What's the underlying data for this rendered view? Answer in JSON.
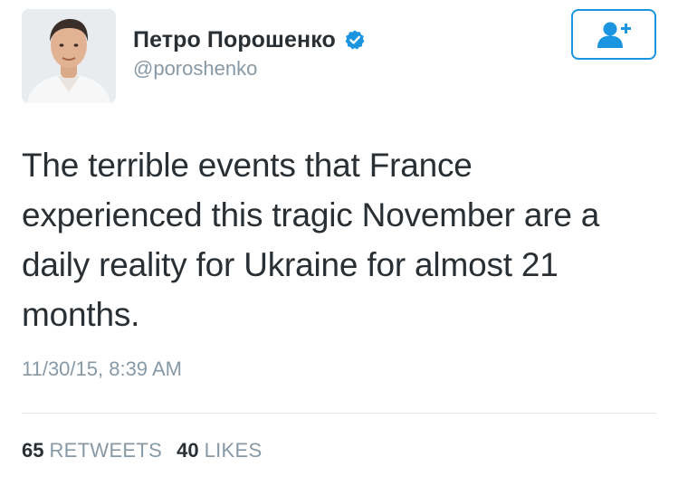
{
  "author": {
    "display_name": "Петро Порошенко",
    "handle": "@poroshenko",
    "verified": true,
    "avatar_icon": "profile-photo"
  },
  "follow_button": {
    "icon": "add-user-icon",
    "color": "#1b95e0"
  },
  "tweet": {
    "text": "The terrible events that France experienced this tragic November are a daily reality for Ukraine for almost 21 months.",
    "timestamp": "11/30/15, 8:39 AM"
  },
  "stats": {
    "retweets_count": "65",
    "retweets_label": "RETWEETS",
    "likes_count": "40",
    "likes_label": "LIKES"
  },
  "colors": {
    "text": "#292f33",
    "muted": "#8899a6",
    "accent": "#1b95e0",
    "divider": "#e1e8ed"
  }
}
